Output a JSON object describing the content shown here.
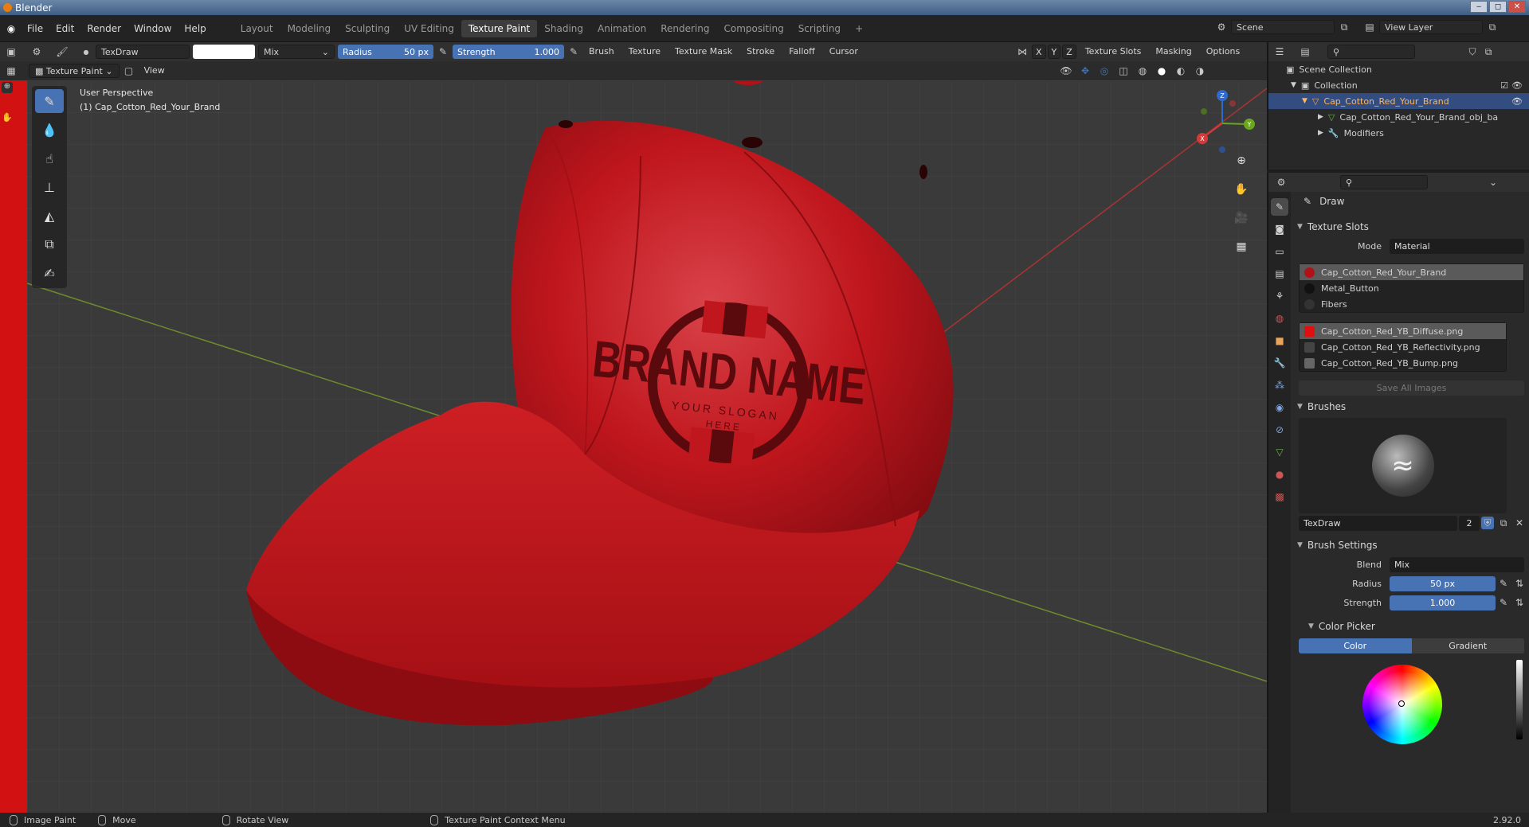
{
  "window": {
    "title": "Blender",
    "minimize": "‒",
    "maximize": "◻",
    "close": "✕"
  },
  "menu": {
    "items": [
      "File",
      "Edit",
      "Render",
      "Window",
      "Help"
    ],
    "workspaces": [
      "Layout",
      "Modeling",
      "Sculpting",
      "UV Editing",
      "Texture Paint",
      "Shading",
      "Animation",
      "Rendering",
      "Compositing",
      "Scripting"
    ],
    "active_workspace": "Texture Paint",
    "add_workspace": "+",
    "scene": "Scene",
    "view_layer": "View Layer"
  },
  "tool_header": {
    "brush_name": "TexDraw",
    "blend": "Mix",
    "radius_label": "Radius",
    "radius_value": "50 px",
    "strength_label": "Strength",
    "strength_value": "1.000",
    "menus": [
      "Brush",
      "Texture",
      "Texture Mask",
      "Stroke",
      "Falloff",
      "Cursor"
    ],
    "axes": [
      "X",
      "Y",
      "Z"
    ],
    "right_menus": [
      "Texture Slots",
      "Masking",
      "Options"
    ],
    "color_hex": "#ffffff"
  },
  "viewport_header": {
    "mode": "Texture Paint",
    "view": "View"
  },
  "viewport": {
    "perspective": "User Perspective",
    "object": "(1) Cap_Cotton_Red_Your_Brand",
    "logo_line1": "BRAND NAME",
    "logo_line2": "YOUR SLOGAN",
    "logo_line3": "HERE",
    "gizmo": {
      "x": "X",
      "y": "Y",
      "z": "Z"
    }
  },
  "outliner": {
    "root": "Scene Collection",
    "collection": "Collection",
    "object": "Cap_Cotton_Red_Your_Brand",
    "mesh": "Cap_Cotton_Red_Your_Brand_obj_ba",
    "modifiers": "Modifiers"
  },
  "properties": {
    "tool_name": "Draw",
    "texture_slots": {
      "header": "Texture Slots",
      "mode_label": "Mode",
      "mode_value": "Material",
      "materials": [
        "Cap_Cotton_Red_Your_Brand",
        "Metal_Button",
        "Fibers"
      ],
      "images": [
        "Cap_Cotton_Red_YB_Diffuse.png",
        "Cap_Cotton_Red_YB_Reflectivity.png",
        "Cap_Cotton_Red_YB_Bump.png"
      ],
      "save_all": "Save All Images"
    },
    "brushes": {
      "header": "Brushes",
      "name": "TexDraw",
      "users": "2"
    },
    "brush_settings": {
      "header": "Brush Settings",
      "blend_label": "Blend",
      "blend_value": "Mix",
      "radius_label": "Radius",
      "radius_value": "50 px",
      "strength_label": "Strength",
      "strength_value": "1.000"
    },
    "color_picker": {
      "header": "Color Picker",
      "tab_color": "Color",
      "tab_gradient": "Gradient"
    }
  },
  "status": {
    "items": [
      "Image Paint",
      "Move",
      "Rotate View",
      "Texture Paint Context Menu"
    ],
    "version": "2.92.0"
  },
  "colors": {
    "accent": "#4772b3",
    "cap_red": "#c4141b",
    "selection": "#334d80"
  }
}
